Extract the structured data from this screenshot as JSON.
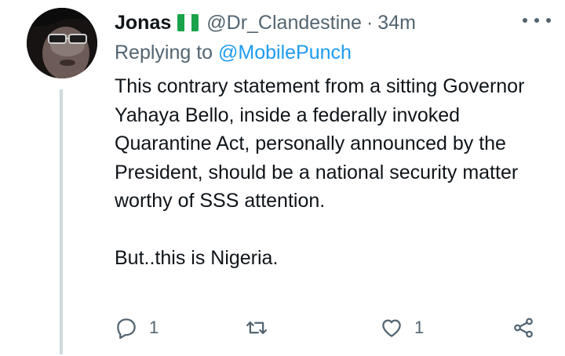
{
  "tweet": {
    "author_name": "Jonas",
    "author_flag": "nigeria-flag",
    "handle": "@Dr_Clandestine",
    "separator": "·",
    "time": "34m",
    "replying_prefix": "Replying to",
    "replying_to": "@MobilePunch",
    "paragraph_1": "This contrary statement from a sitting Governor Yahaya Bello, inside a federally invoked Quarantine Act, personally announced by the President, should be a national security matter worthy of SSS attention.",
    "paragraph_2": "But..this is Nigeria."
  },
  "actions": {
    "reply_count": "1",
    "like_count": "1"
  },
  "icons": {
    "reply": "comment-icon",
    "retweet": "retweet-icon",
    "like": "heart-icon",
    "share": "share-icon",
    "more": "more-icon"
  },
  "colors": {
    "text": "#0f1419",
    "secondary": "#536471",
    "link": "#1d9bf0",
    "thread_line": "#cfd9de",
    "flag_green": "#1aa34a"
  }
}
